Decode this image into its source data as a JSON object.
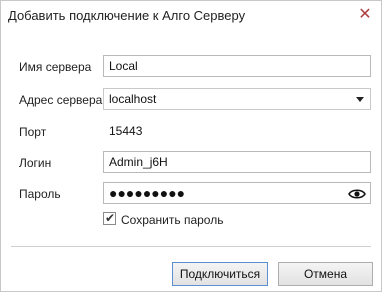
{
  "window": {
    "title": "Добавить подключение к Алго Серверу",
    "close_icon": "close-icon"
  },
  "form": {
    "server_name": {
      "label": "Имя сервера",
      "value": "Local"
    },
    "server_address": {
      "label": "Адрес сервера",
      "value": "localhost"
    },
    "port": {
      "label": "Порт",
      "value": "15443"
    },
    "login": {
      "label": "Логин",
      "value": "Admin_j6H"
    },
    "password": {
      "label": "Пароль",
      "masked": "●●●●●●●●●",
      "reveal_icon": "eye-icon"
    },
    "save_password": {
      "label": "Сохранить пароль",
      "checked": true
    }
  },
  "buttons": {
    "connect": "Подключиться",
    "cancel": "Отмена"
  }
}
